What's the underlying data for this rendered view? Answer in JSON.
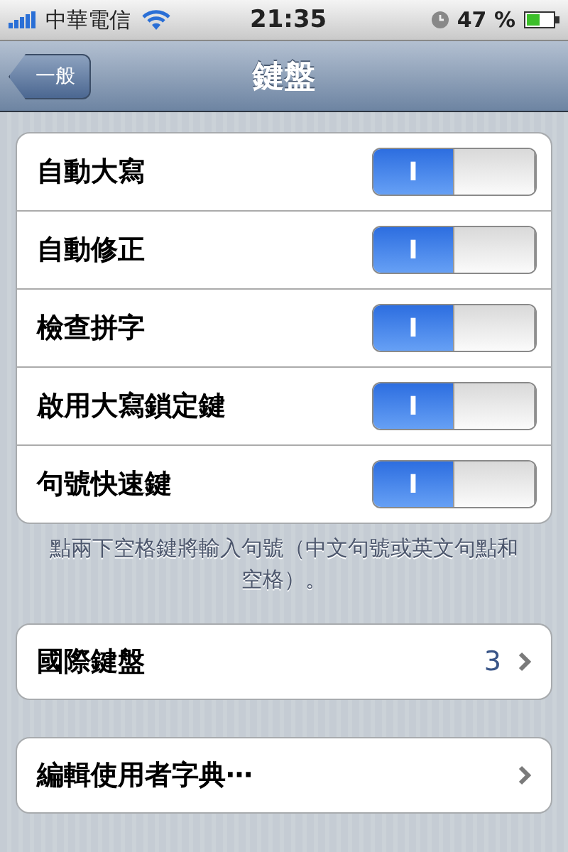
{
  "status_bar": {
    "carrier": "中華電信",
    "time": "21:35",
    "battery": "47 %"
  },
  "nav_bar": {
    "back": "一般",
    "title": "鍵盤"
  },
  "toggles": [
    {
      "label": "自動大寫",
      "on": true,
      "switch_text": "I"
    },
    {
      "label": "自動修正",
      "on": true,
      "switch_text": "I"
    },
    {
      "label": "檢查拼字",
      "on": true,
      "switch_text": "I"
    },
    {
      "label": "啟用大寫鎖定鍵",
      "on": true,
      "switch_text": "I"
    },
    {
      "label": "句號快速鍵",
      "on": true,
      "switch_text": "I"
    }
  ],
  "toggles_footer": "點兩下空格鍵將輸入句號（中文句號或英文句點和空格）。",
  "links": [
    {
      "label": "國際鍵盤",
      "value": "3"
    },
    {
      "label": "編輯使用者字典⋯"
    }
  ]
}
